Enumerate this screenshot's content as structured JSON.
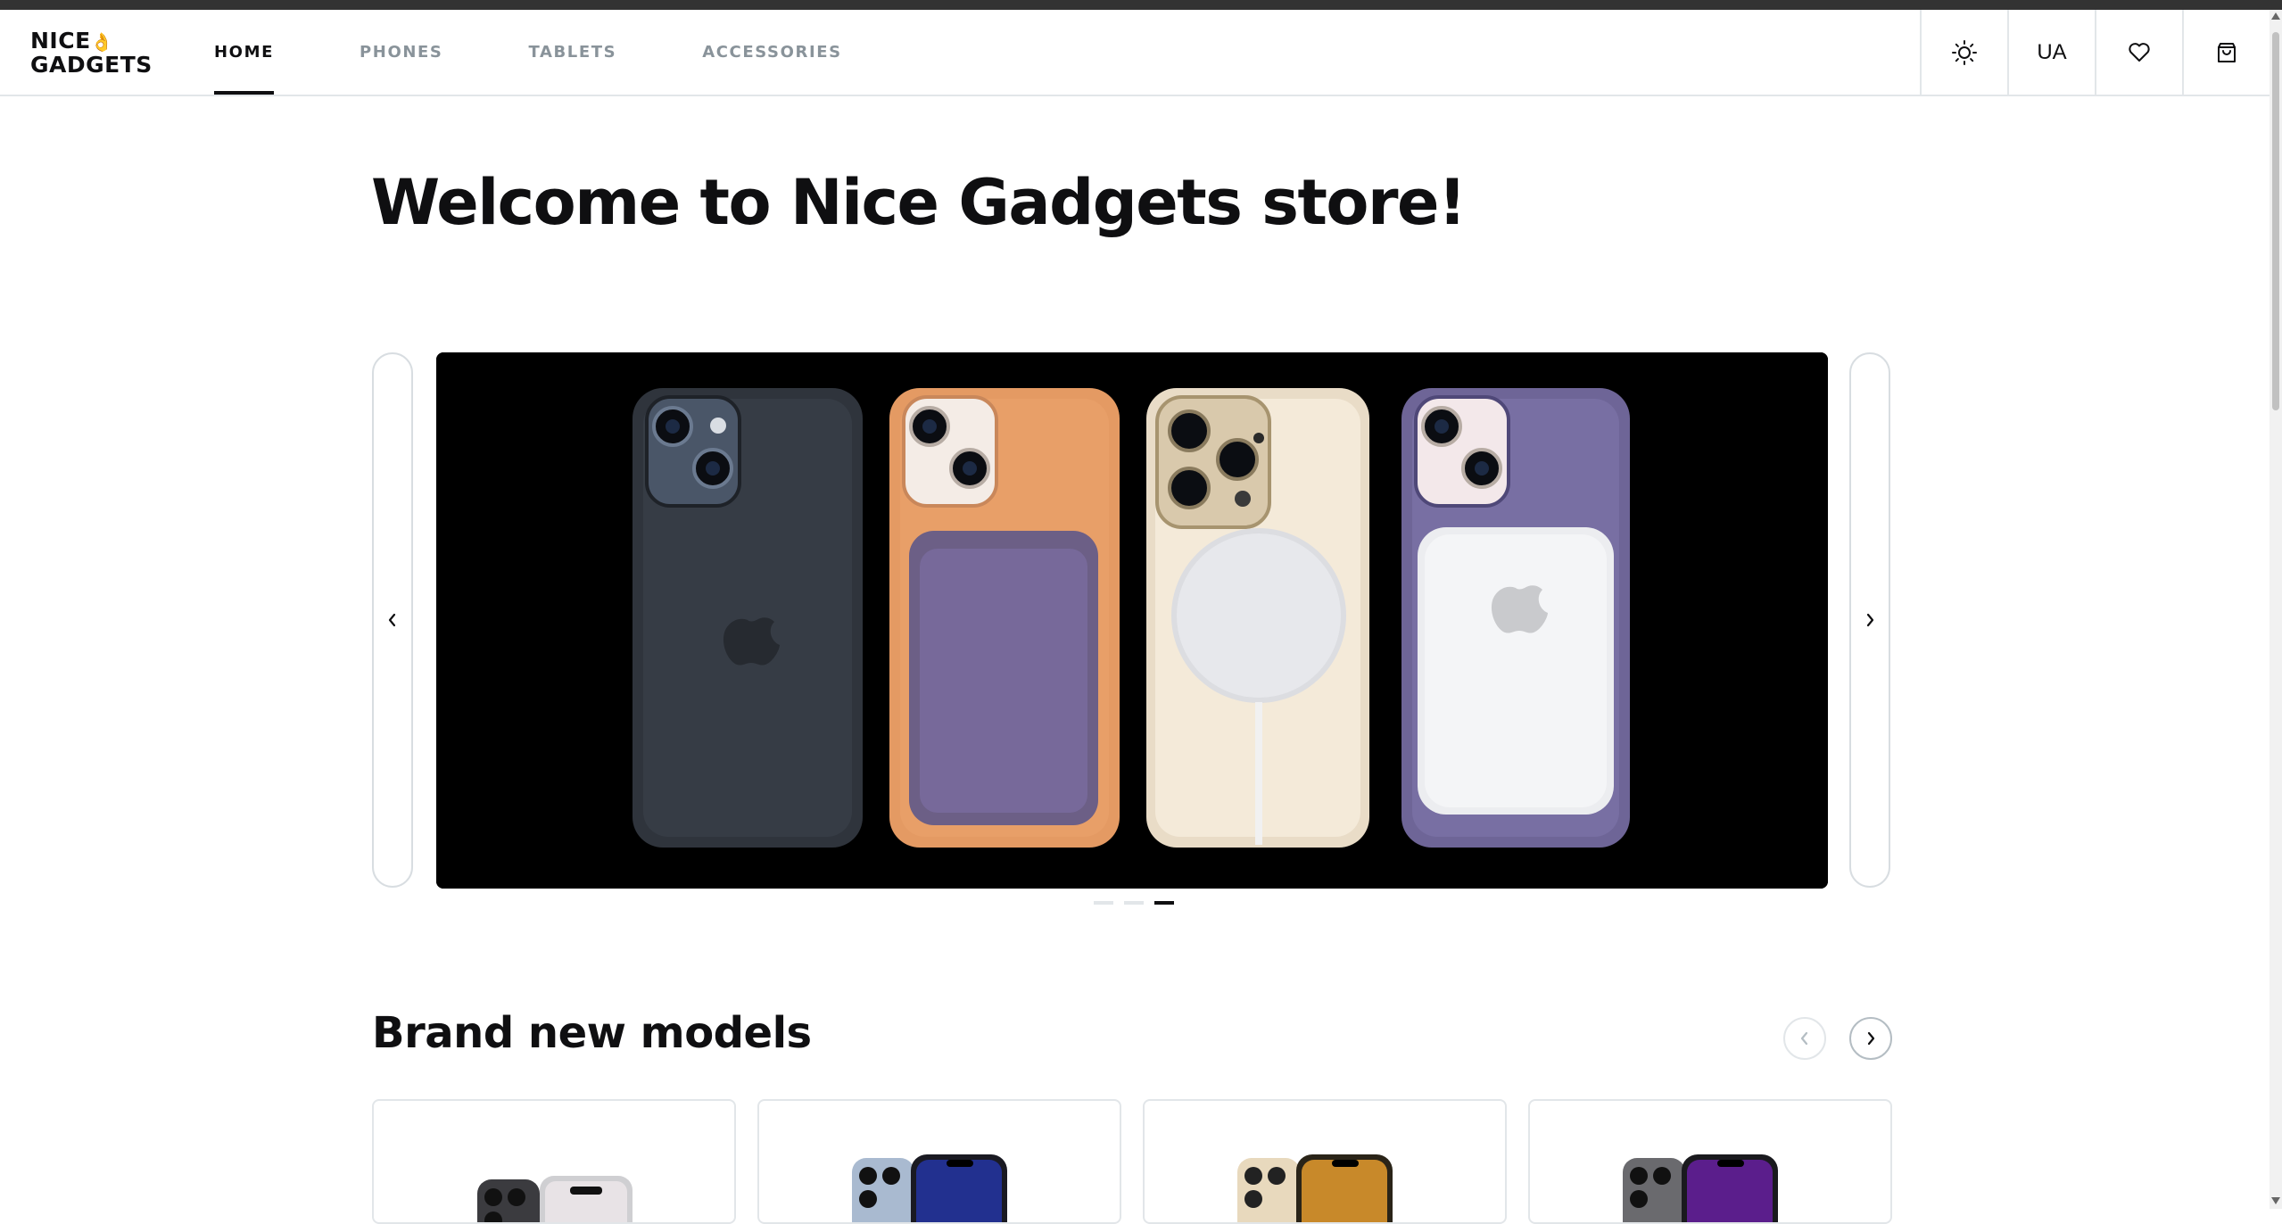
{
  "brand": {
    "line1": "NICE",
    "hand": "👌",
    "line2": "GADGETS"
  },
  "nav": {
    "items": [
      {
        "label": "HOME",
        "active": true
      },
      {
        "label": "PHONES",
        "active": false
      },
      {
        "label": "TABLETS",
        "active": false
      },
      {
        "label": "ACCESSORIES",
        "active": false
      }
    ]
  },
  "header_actions": {
    "theme_icon": "sun-icon",
    "language": "UA",
    "favorites_icon": "heart-icon",
    "cart_icon": "shopping-bag-icon"
  },
  "hero": {
    "title": "Welcome to Nice Gadgets store!",
    "slides_count": 3,
    "active_slide": 3,
    "banner_products": [
      "Midnight silicone case",
      "Orange case with leather wallet",
      "Gold iPhone with MagSafe charger",
      "Purple case with MagSafe battery pack"
    ]
  },
  "section": {
    "title": "Brand new models"
  },
  "colors": {
    "primary": "#0f0f11",
    "secondary": "#89939a",
    "elements": "#e2e6e9",
    "accent": "#f2b233"
  }
}
